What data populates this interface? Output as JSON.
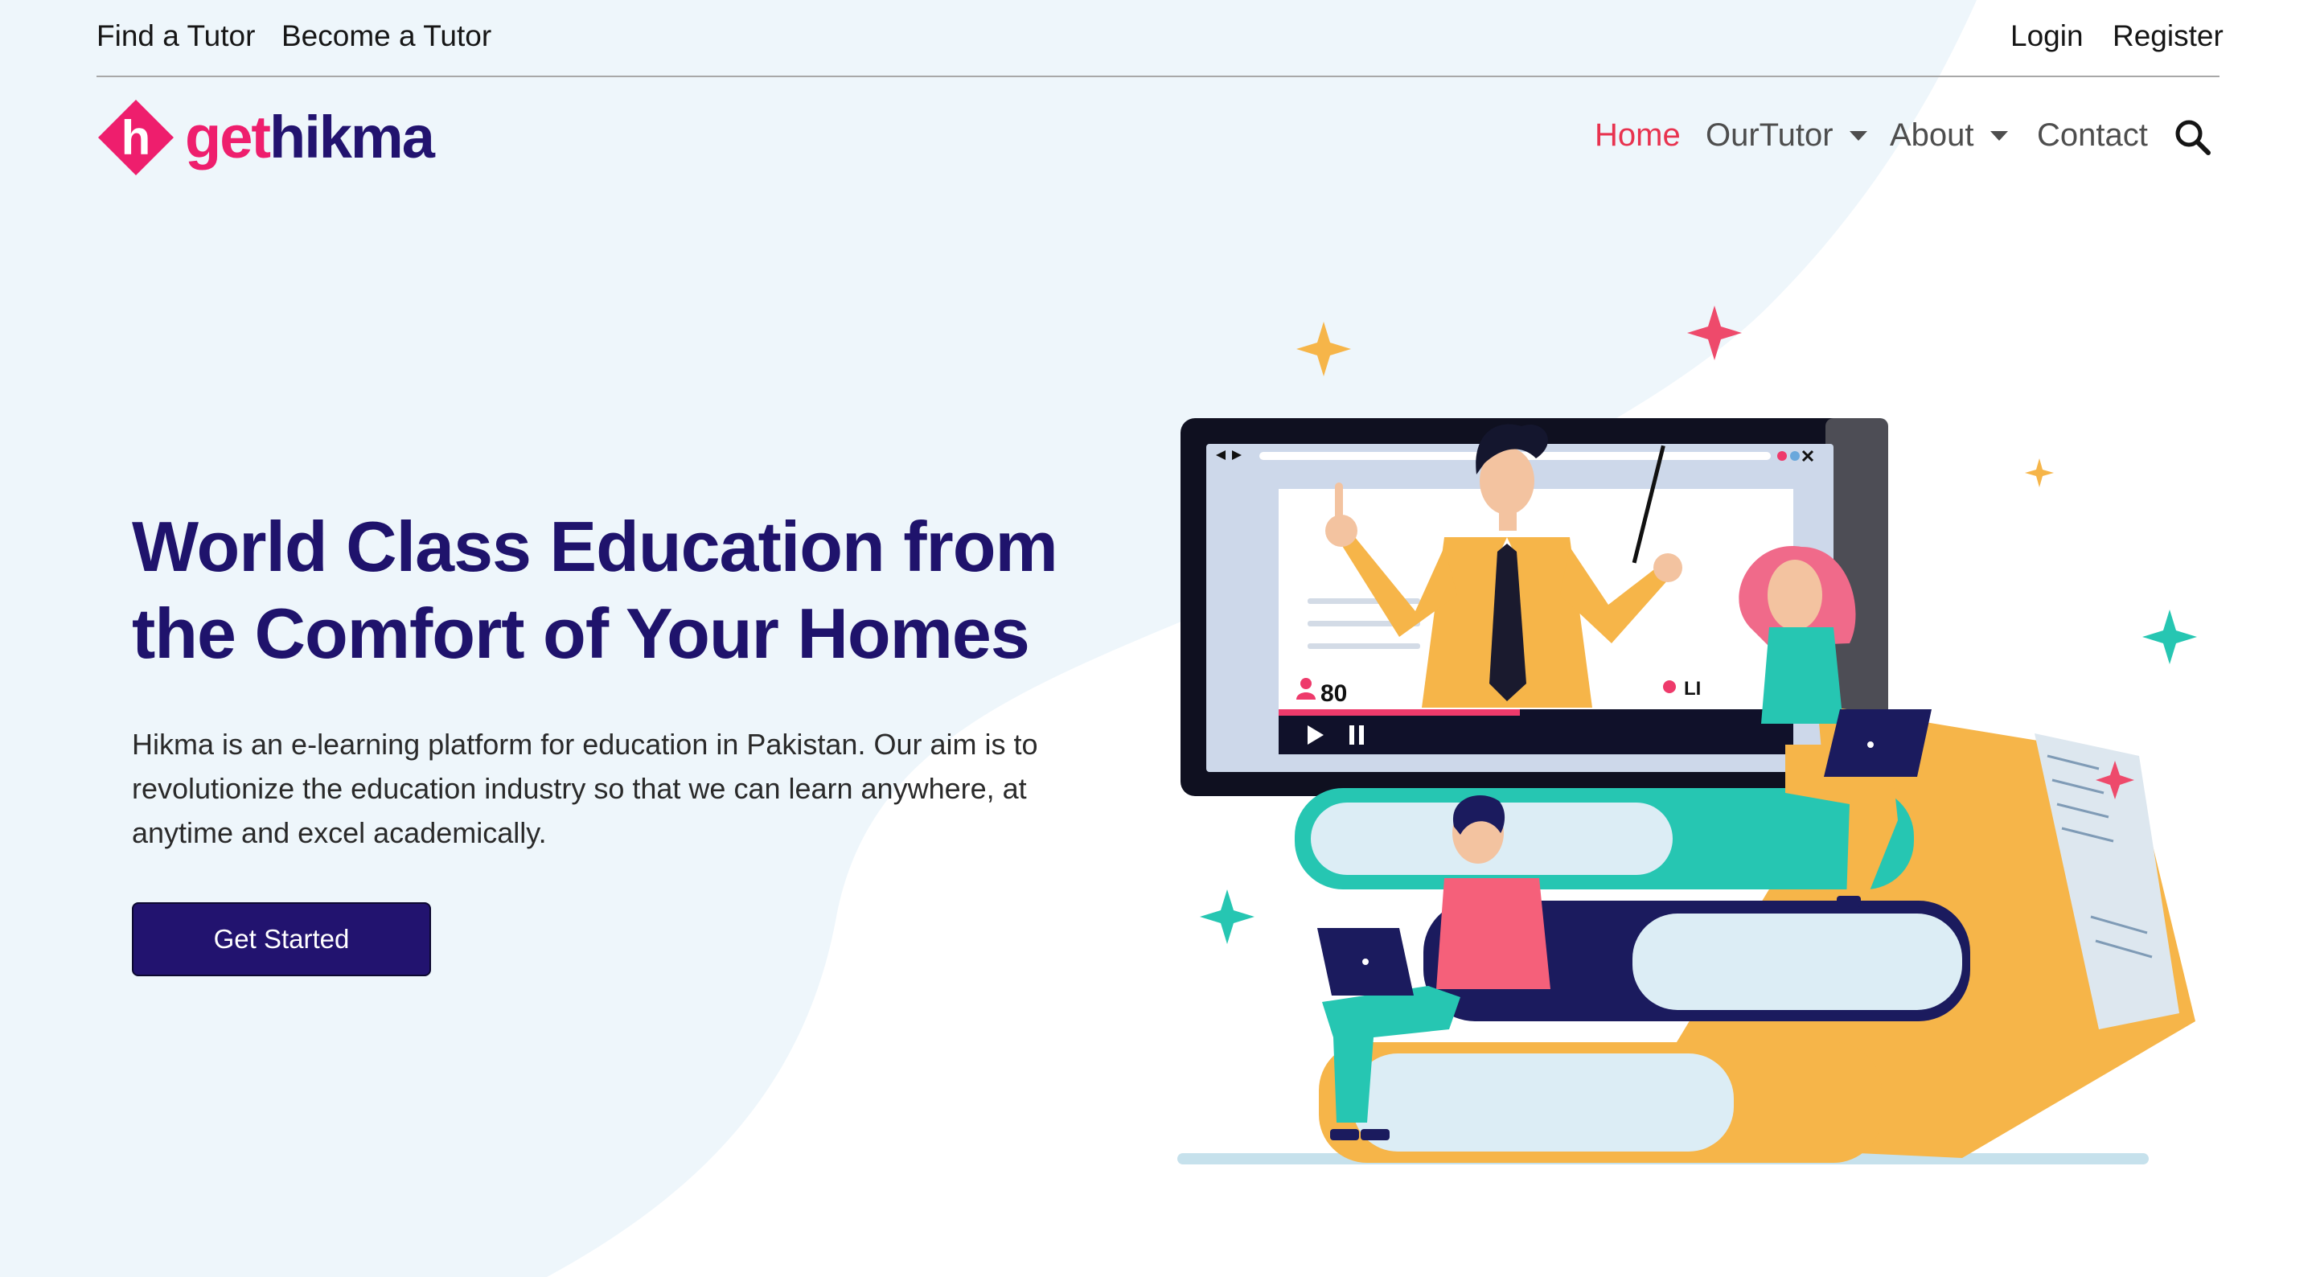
{
  "topbar": {
    "find_tutor": "Find a Tutor",
    "become_tutor": "Become a Tutor",
    "login": "Login",
    "register": "Register"
  },
  "logo": {
    "mark": "h",
    "part1": "get",
    "part2": "hikma"
  },
  "nav": {
    "home": "Home",
    "our_tutor": "OurTutor",
    "about": "About",
    "contact": "Contact"
  },
  "hero": {
    "title_line1": "World Class Education from",
    "title_line2": "the Comfort of Your Homes",
    "description": "Hikma is an e-learning platform for education in Pakistan. Our aim is to revolutionize the education industry so that we can learn anywhere, at anytime and excel academically.",
    "cta": "Get Started"
  },
  "illustration": {
    "viewer_count": "80",
    "live_label": "LI"
  },
  "colors": {
    "brand_pink": "#ee1e6d",
    "brand_navy": "#22136f",
    "nav_active": "#e8334f",
    "background_tint": "#eef6fb"
  },
  "icons": [
    "hikma-logo-icon",
    "search-icon",
    "chevron-down-icon",
    "play-icon",
    "pause-icon",
    "viewer-icon"
  ]
}
